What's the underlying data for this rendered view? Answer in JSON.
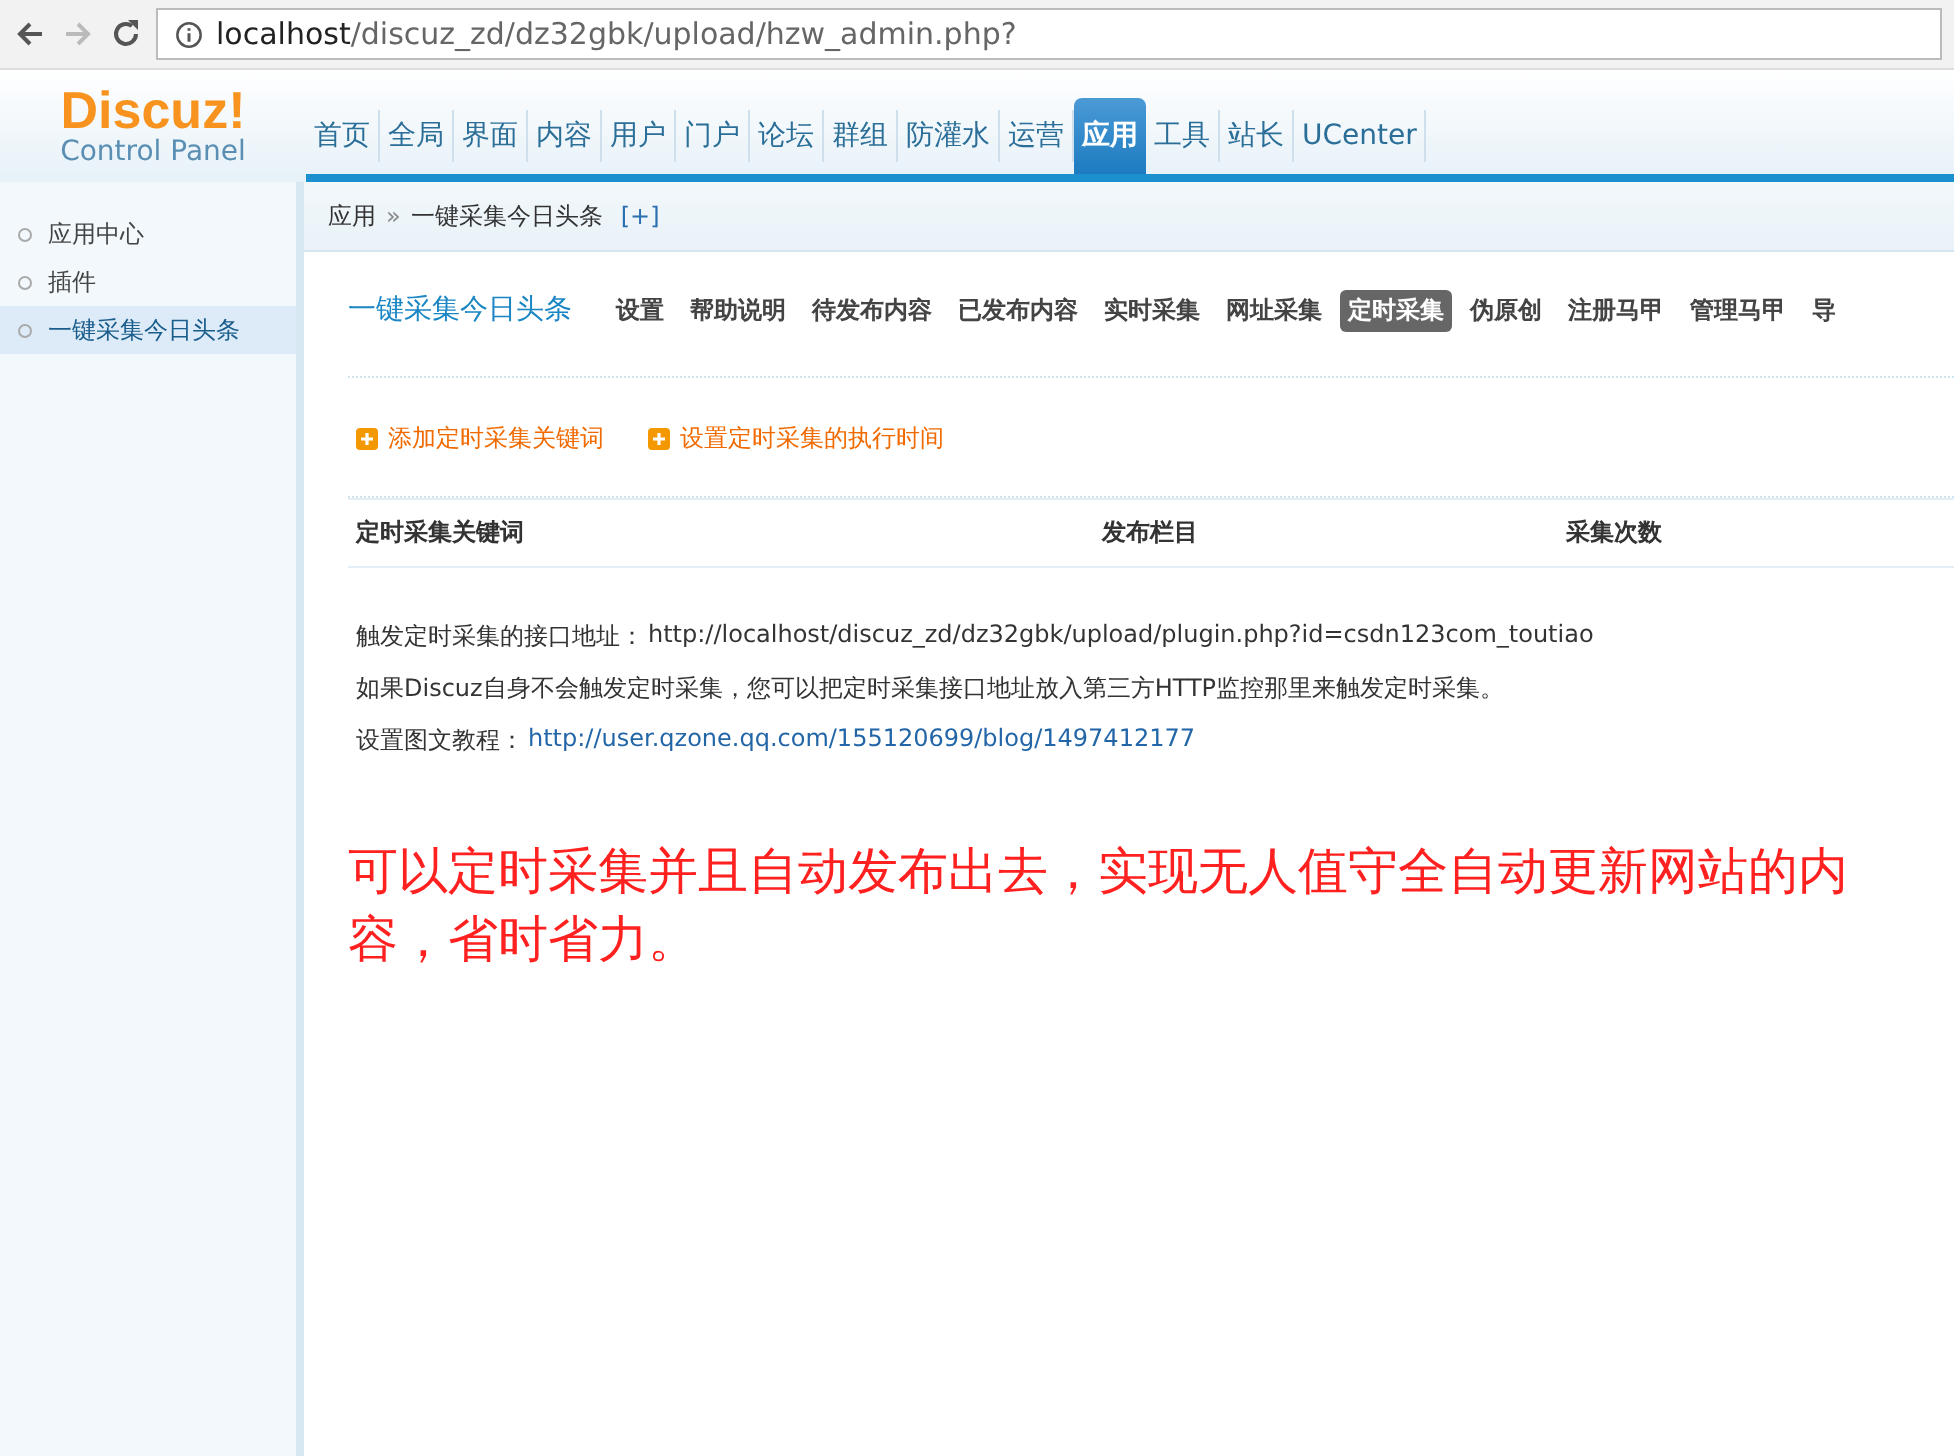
{
  "browser": {
    "url_host": "localhost",
    "url_path": "/discuz_zd/dz32gbk/upload/hzw_admin.php?"
  },
  "header": {
    "logo": "Discuz!",
    "logo_subtitle": "Control Panel",
    "nav": [
      {
        "label": "首页",
        "selected": false
      },
      {
        "label": "全局",
        "selected": false
      },
      {
        "label": "界面",
        "selected": false
      },
      {
        "label": "内容",
        "selected": false
      },
      {
        "label": "用户",
        "selected": false
      },
      {
        "label": "门户",
        "selected": false
      },
      {
        "label": "论坛",
        "selected": false
      },
      {
        "label": "群组",
        "selected": false
      },
      {
        "label": "防灌水",
        "selected": false
      },
      {
        "label": "运营",
        "selected": false
      },
      {
        "label": "应用",
        "selected": true
      },
      {
        "label": "工具",
        "selected": false
      },
      {
        "label": "站长",
        "selected": false
      },
      {
        "label": "UCenter",
        "selected": false
      }
    ]
  },
  "breadcrumb": {
    "items": [
      "应用",
      "一键采集今日头条"
    ],
    "separator": "»",
    "add": "[+]"
  },
  "sidebar": {
    "items": [
      {
        "label": "应用中心",
        "selected": false
      },
      {
        "label": "插件",
        "selected": false
      },
      {
        "label": "一键采集今日头条",
        "selected": true
      }
    ]
  },
  "plugin": {
    "title": "一键采集今日头条",
    "tabs": [
      {
        "label": "设置",
        "selected": false
      },
      {
        "label": "帮助说明",
        "selected": false
      },
      {
        "label": "待发布内容",
        "selected": false
      },
      {
        "label": "已发布内容",
        "selected": false
      },
      {
        "label": "实时采集",
        "selected": false
      },
      {
        "label": "网址采集",
        "selected": false
      },
      {
        "label": "定时采集",
        "selected": true
      },
      {
        "label": "伪原创",
        "selected": false
      },
      {
        "label": "注册马甲",
        "selected": false
      },
      {
        "label": "管理马甲",
        "selected": false
      },
      {
        "label": "导",
        "selected": false
      }
    ],
    "actions": [
      "添加定时采集关键词",
      "设置定时采集的执行时间"
    ],
    "table": {
      "columns": [
        "定时采集关键词",
        "发布栏目",
        "采集次数"
      ]
    },
    "notes": [
      {
        "label": "触发定时采集的接口地址：",
        "value": "http://localhost/discuz_zd/dz32gbk/upload/plugin.php?id=csdn123com_toutiao",
        "kind": "text"
      },
      {
        "label": "如果Discuz自身不会触发定时采集，您可以把定时采集接口地址放入第三方HTTP监控那里来触发定时采集。",
        "kind": "plain"
      },
      {
        "label": "设置图文教程：",
        "value": "http://user.qzone.qq.com/155120699/blog/1497412177",
        "kind": "link"
      }
    ],
    "annotation": "可以定时采集并且自动发布出去，实现无人值守全自动更新网站的内容，省时省力。"
  }
}
